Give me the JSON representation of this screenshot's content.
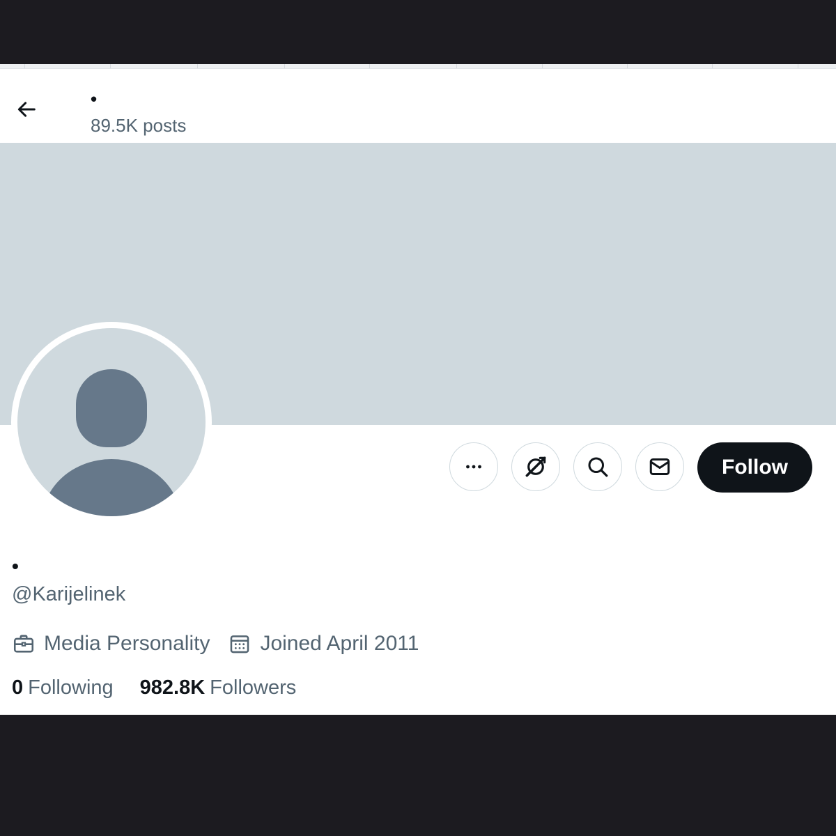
{
  "header": {
    "display_name": "•",
    "post_count": "89.5K posts"
  },
  "profile": {
    "display_name": "•",
    "handle": "@Karijelinek",
    "category": "Media Personality",
    "joined": "Joined April 2011",
    "following_count": "0",
    "following_label": "Following",
    "followers_count": "982.8K",
    "followers_label": "Followers"
  },
  "actions": {
    "follow_label": "Follow"
  },
  "icons": {
    "back": "arrow-left-icon",
    "more": "more-horizontal-icon",
    "grok": "grok-icon",
    "search": "search-icon",
    "message": "envelope-icon",
    "category": "briefcase-icon",
    "joined": "calendar-icon"
  },
  "colors": {
    "banner": "#cfd9de",
    "avatar_bg": "#cfd9de",
    "avatar_figure": "#66788a",
    "follow_button": "#0f1419",
    "secondary_text": "#536471",
    "primary_text": "#0f1419",
    "outer_frame": "#1c1b20"
  }
}
